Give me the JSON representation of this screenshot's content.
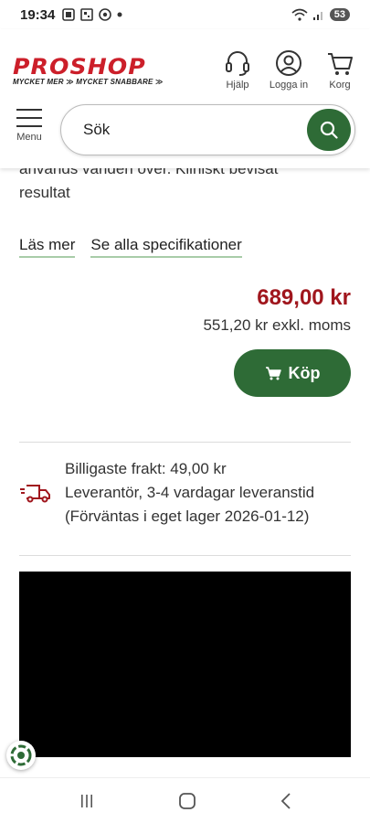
{
  "status_bar": {
    "time": "19:34",
    "battery": "53"
  },
  "header": {
    "logo_text": "PROSHOP",
    "logo_tagline": "MYCKET MER ≫ MYCKET SNABBARE ≫",
    "help_label": "Hjälp",
    "login_label": "Logga in",
    "cart_label": "Korg",
    "menu_label": "Menu",
    "search_placeholder": "Sök"
  },
  "product": {
    "description_line1": "används världen över. Kliniskt bevisat",
    "description_line2": "resultat",
    "read_more": "Läs mer",
    "all_specs": "Se alla specifikationer",
    "price": "689,00 kr",
    "price_ex_vat": "551,20 kr exkl. moms",
    "buy_label": "Köp"
  },
  "shipping": {
    "line1": "Billigaste frakt: 49,00 kr",
    "line2": "Leverantör, 3-4 vardagar leveranstid",
    "line3": "(Förväntas i eget lager 2026-01-12)"
  },
  "colors": {
    "brand_red": "#cc1f2a",
    "price_red": "#a0161d",
    "accent_green": "#2e6b36"
  },
  "icons": [
    "headset-icon",
    "user-icon",
    "cart-icon",
    "menu-icon",
    "search-icon",
    "truck-icon"
  ]
}
